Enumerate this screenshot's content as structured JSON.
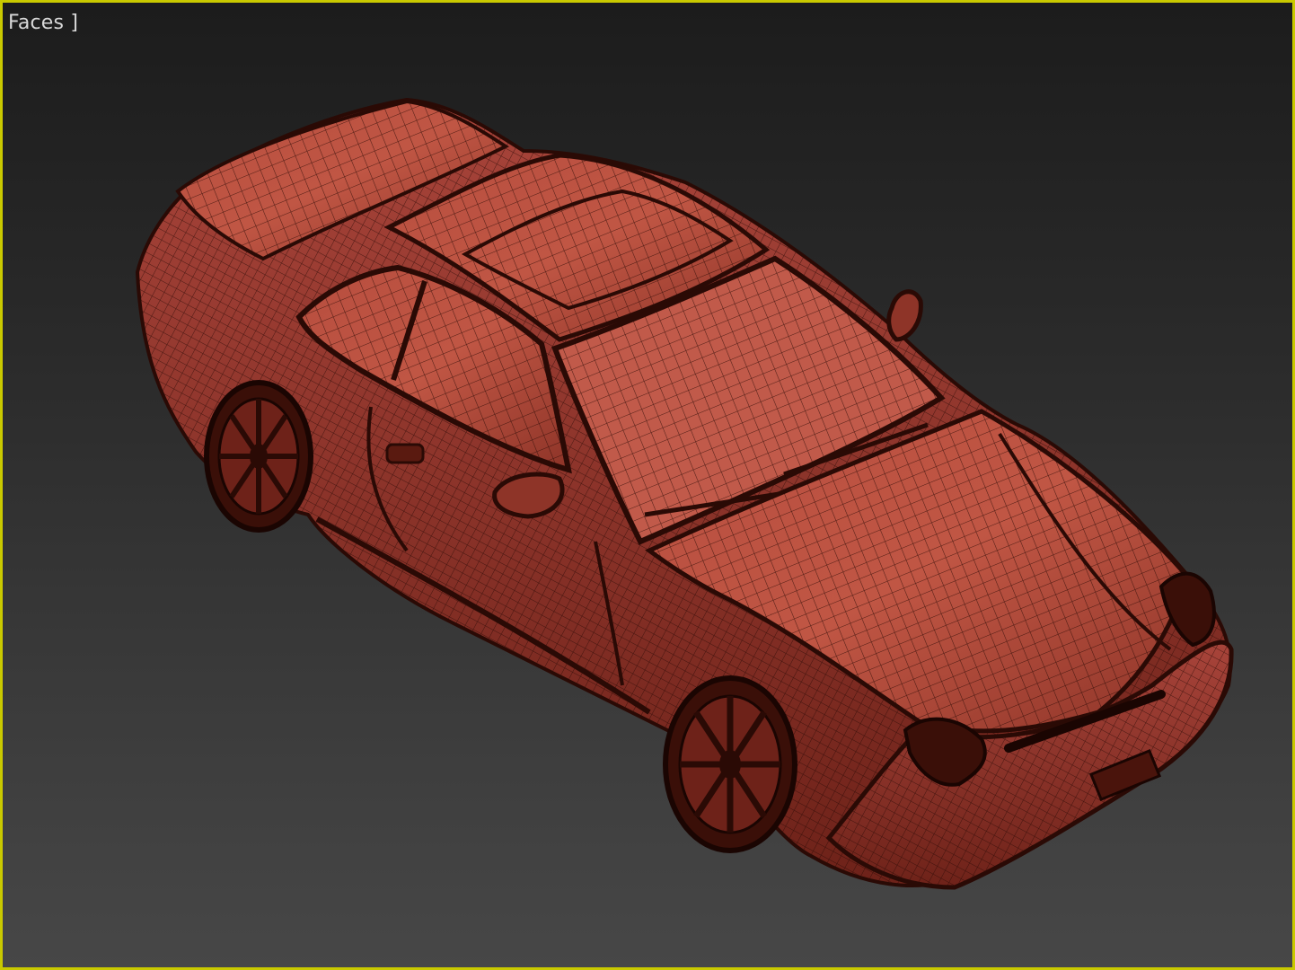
{
  "viewport": {
    "label": "Faces ]",
    "model_name": "car-wireframe-model",
    "shading": "Faces",
    "colors": {
      "border": "#c9c900",
      "body_fill": "#b0473a",
      "body_light": "#c85a4a",
      "wire": "#2a0a05",
      "label": "#d8d8d8"
    }
  }
}
